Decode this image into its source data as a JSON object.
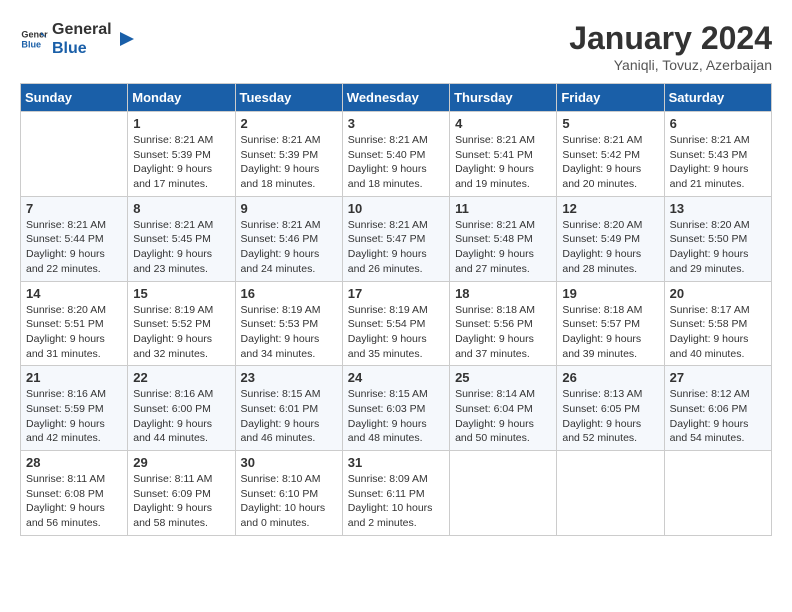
{
  "header": {
    "logo_general": "General",
    "logo_blue": "Blue",
    "month_title": "January 2024",
    "subtitle": "Yaniqli, Tovuz, Azerbaijan"
  },
  "days_of_week": [
    "Sunday",
    "Monday",
    "Tuesday",
    "Wednesday",
    "Thursday",
    "Friday",
    "Saturday"
  ],
  "weeks": [
    [
      {
        "day": "",
        "sunrise": "",
        "sunset": "",
        "daylight": ""
      },
      {
        "day": "1",
        "sunrise": "Sunrise: 8:21 AM",
        "sunset": "Sunset: 5:39 PM",
        "daylight": "Daylight: 9 hours and 17 minutes."
      },
      {
        "day": "2",
        "sunrise": "Sunrise: 8:21 AM",
        "sunset": "Sunset: 5:39 PM",
        "daylight": "Daylight: 9 hours and 18 minutes."
      },
      {
        "day": "3",
        "sunrise": "Sunrise: 8:21 AM",
        "sunset": "Sunset: 5:40 PM",
        "daylight": "Daylight: 9 hours and 18 minutes."
      },
      {
        "day": "4",
        "sunrise": "Sunrise: 8:21 AM",
        "sunset": "Sunset: 5:41 PM",
        "daylight": "Daylight: 9 hours and 19 minutes."
      },
      {
        "day": "5",
        "sunrise": "Sunrise: 8:21 AM",
        "sunset": "Sunset: 5:42 PM",
        "daylight": "Daylight: 9 hours and 20 minutes."
      },
      {
        "day": "6",
        "sunrise": "Sunrise: 8:21 AM",
        "sunset": "Sunset: 5:43 PM",
        "daylight": "Daylight: 9 hours and 21 minutes."
      }
    ],
    [
      {
        "day": "7",
        "sunrise": "Sunrise: 8:21 AM",
        "sunset": "Sunset: 5:44 PM",
        "daylight": "Daylight: 9 hours and 22 minutes."
      },
      {
        "day": "8",
        "sunrise": "Sunrise: 8:21 AM",
        "sunset": "Sunset: 5:45 PM",
        "daylight": "Daylight: 9 hours and 23 minutes."
      },
      {
        "day": "9",
        "sunrise": "Sunrise: 8:21 AM",
        "sunset": "Sunset: 5:46 PM",
        "daylight": "Daylight: 9 hours and 24 minutes."
      },
      {
        "day": "10",
        "sunrise": "Sunrise: 8:21 AM",
        "sunset": "Sunset: 5:47 PM",
        "daylight": "Daylight: 9 hours and 26 minutes."
      },
      {
        "day": "11",
        "sunrise": "Sunrise: 8:21 AM",
        "sunset": "Sunset: 5:48 PM",
        "daylight": "Daylight: 9 hours and 27 minutes."
      },
      {
        "day": "12",
        "sunrise": "Sunrise: 8:20 AM",
        "sunset": "Sunset: 5:49 PM",
        "daylight": "Daylight: 9 hours and 28 minutes."
      },
      {
        "day": "13",
        "sunrise": "Sunrise: 8:20 AM",
        "sunset": "Sunset: 5:50 PM",
        "daylight": "Daylight: 9 hours and 29 minutes."
      }
    ],
    [
      {
        "day": "14",
        "sunrise": "Sunrise: 8:20 AM",
        "sunset": "Sunset: 5:51 PM",
        "daylight": "Daylight: 9 hours and 31 minutes."
      },
      {
        "day": "15",
        "sunrise": "Sunrise: 8:19 AM",
        "sunset": "Sunset: 5:52 PM",
        "daylight": "Daylight: 9 hours and 32 minutes."
      },
      {
        "day": "16",
        "sunrise": "Sunrise: 8:19 AM",
        "sunset": "Sunset: 5:53 PM",
        "daylight": "Daylight: 9 hours and 34 minutes."
      },
      {
        "day": "17",
        "sunrise": "Sunrise: 8:19 AM",
        "sunset": "Sunset: 5:54 PM",
        "daylight": "Daylight: 9 hours and 35 minutes."
      },
      {
        "day": "18",
        "sunrise": "Sunrise: 8:18 AM",
        "sunset": "Sunset: 5:56 PM",
        "daylight": "Daylight: 9 hours and 37 minutes."
      },
      {
        "day": "19",
        "sunrise": "Sunrise: 8:18 AM",
        "sunset": "Sunset: 5:57 PM",
        "daylight": "Daylight: 9 hours and 39 minutes."
      },
      {
        "day": "20",
        "sunrise": "Sunrise: 8:17 AM",
        "sunset": "Sunset: 5:58 PM",
        "daylight": "Daylight: 9 hours and 40 minutes."
      }
    ],
    [
      {
        "day": "21",
        "sunrise": "Sunrise: 8:16 AM",
        "sunset": "Sunset: 5:59 PM",
        "daylight": "Daylight: 9 hours and 42 minutes."
      },
      {
        "day": "22",
        "sunrise": "Sunrise: 8:16 AM",
        "sunset": "Sunset: 6:00 PM",
        "daylight": "Daylight: 9 hours and 44 minutes."
      },
      {
        "day": "23",
        "sunrise": "Sunrise: 8:15 AM",
        "sunset": "Sunset: 6:01 PM",
        "daylight": "Daylight: 9 hours and 46 minutes."
      },
      {
        "day": "24",
        "sunrise": "Sunrise: 8:15 AM",
        "sunset": "Sunset: 6:03 PM",
        "daylight": "Daylight: 9 hours and 48 minutes."
      },
      {
        "day": "25",
        "sunrise": "Sunrise: 8:14 AM",
        "sunset": "Sunset: 6:04 PM",
        "daylight": "Daylight: 9 hours and 50 minutes."
      },
      {
        "day": "26",
        "sunrise": "Sunrise: 8:13 AM",
        "sunset": "Sunset: 6:05 PM",
        "daylight": "Daylight: 9 hours and 52 minutes."
      },
      {
        "day": "27",
        "sunrise": "Sunrise: 8:12 AM",
        "sunset": "Sunset: 6:06 PM",
        "daylight": "Daylight: 9 hours and 54 minutes."
      }
    ],
    [
      {
        "day": "28",
        "sunrise": "Sunrise: 8:11 AM",
        "sunset": "Sunset: 6:08 PM",
        "daylight": "Daylight: 9 hours and 56 minutes."
      },
      {
        "day": "29",
        "sunrise": "Sunrise: 8:11 AM",
        "sunset": "Sunset: 6:09 PM",
        "daylight": "Daylight: 9 hours and 58 minutes."
      },
      {
        "day": "30",
        "sunrise": "Sunrise: 8:10 AM",
        "sunset": "Sunset: 6:10 PM",
        "daylight": "Daylight: 10 hours and 0 minutes."
      },
      {
        "day": "31",
        "sunrise": "Sunrise: 8:09 AM",
        "sunset": "Sunset: 6:11 PM",
        "daylight": "Daylight: 10 hours and 2 minutes."
      },
      {
        "day": "",
        "sunrise": "",
        "sunset": "",
        "daylight": ""
      },
      {
        "day": "",
        "sunrise": "",
        "sunset": "",
        "daylight": ""
      },
      {
        "day": "",
        "sunrise": "",
        "sunset": "",
        "daylight": ""
      }
    ]
  ]
}
